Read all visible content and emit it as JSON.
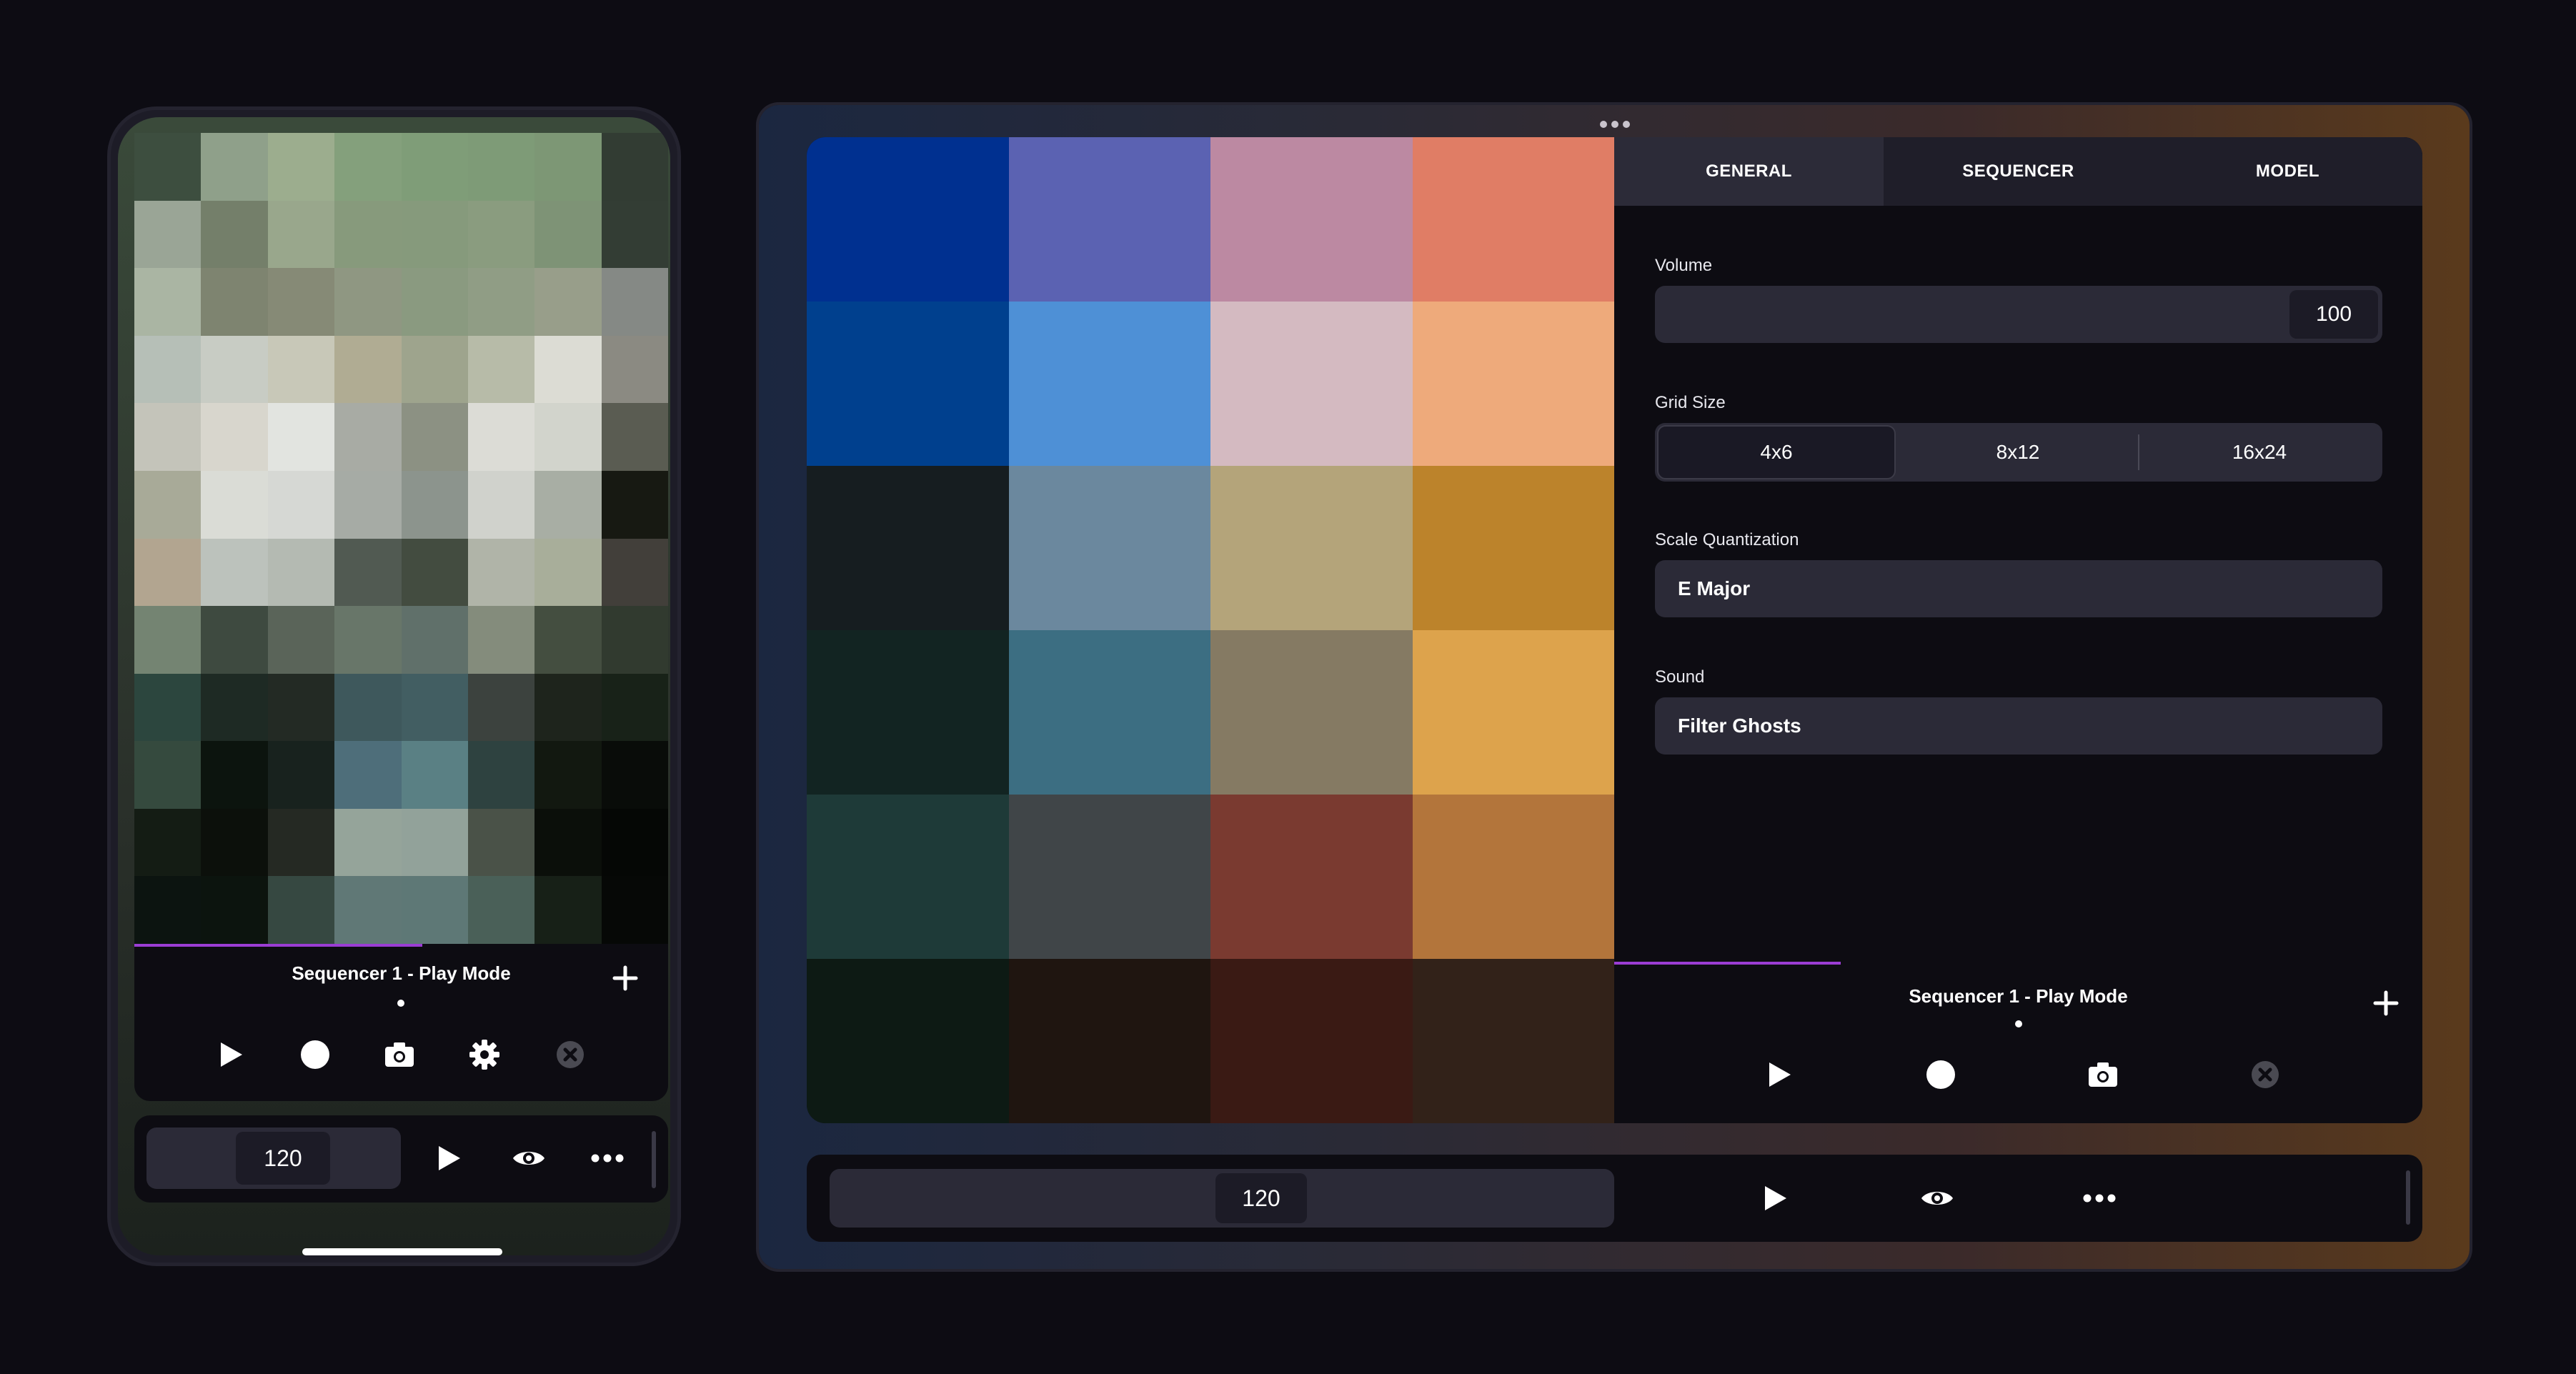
{
  "phone": {
    "grid_colors": [
      [
        "#3d4e3f",
        "#8fa08a",
        "#9cad8e",
        "#84a07c",
        "#7f9d78",
        "#7e9b77",
        "#7d9775",
        "#323c33"
      ],
      [
        "#9aa596",
        "#747f6a",
        "#99a78c",
        "#879a7c",
        "#869a7c",
        "#8a9c7f",
        "#7e9376",
        "#333d34"
      ],
      [
        "#aab5a3",
        "#7e8470",
        "#868a76",
        "#8f9782",
        "#8a9a80",
        "#909d85",
        "#989e8a",
        "#858985"
      ],
      [
        "#b6bfb7",
        "#c8ccc4",
        "#c8c8b8",
        "#b0ac93",
        "#9ea48d",
        "#b7bba8",
        "#dcdcd4",
        "#8b8a82"
      ],
      [
        "#c4c4ba",
        "#d8d6cd",
        "#e2e4e0",
        "#a8aba4",
        "#8c9183",
        "#dcdcd6",
        "#d2d4cc",
        "#5a5c52"
      ],
      [
        "#a8aa98",
        "#dadcd6",
        "#d6d8d4",
        "#a6aba5",
        "#8c948d",
        "#d0d2cc",
        "#a8aea4",
        "#171912"
      ],
      [
        "#b2a590",
        "#bcc2bc",
        "#b4bab2",
        "#515a52",
        "#434c40",
        "#b0b4a8",
        "#a8ae9a",
        "#423f3a"
      ],
      [
        "#748472",
        "#3e4a40",
        "#5a6459",
        "#687669",
        "#60706a",
        "#848c7c",
        "#444e40",
        "#313a2f"
      ],
      [
        "#2c463e",
        "#1e2a24",
        "#232a24",
        "#3e585c",
        "#425e62",
        "#3c423e",
        "#1e241c",
        "#182218"
      ],
      [
        "#354a3e",
        "#0c140e",
        "#18221e",
        "#4e6e7a",
        "#5a8084",
        "#2e4240",
        "#121810",
        "#090c09"
      ],
      [
        "#141c14",
        "#0c100b",
        "#252923",
        "#95a49a",
        "#92a29a",
        "#4a5248",
        "#0b0f0a",
        "#050705"
      ],
      [
        "#0c1410",
        "#0c140e",
        "#364841",
        "#607876",
        "#5e7876",
        "#4a6058",
        "#172017",
        "#060806"
      ]
    ],
    "sequencer_title": "Sequencer 1 - Play Mode",
    "tempo": "120",
    "progress_fraction": 0.54
  },
  "tablet": {
    "grid_colors": [
      [
        "#003090",
        "#5b62b2",
        "#bc89a2",
        "#e07d65"
      ],
      [
        "#00408e",
        "#4e90d6",
        "#d4bac1",
        "#eeaa7b"
      ],
      [
        "#161d20",
        "#6b889e",
        "#b4a47a",
        "#bc832b"
      ],
      [
        "#122422",
        "#3c6e82",
        "#857a63",
        "#dda34c"
      ],
      [
        "#1e3a38",
        "#404548",
        "#7a3a30",
        "#b3753b"
      ],
      [
        "#0d1a14",
        "#1f1510",
        "#3a1a14",
        "#322219"
      ]
    ],
    "tabs": [
      "GENERAL",
      "SEQUENCER",
      "MODEL"
    ],
    "settings": {
      "volume_label": "Volume",
      "volume_value": "100",
      "grid_size_label": "Grid Size",
      "grid_options": [
        "4x6",
        "8x12",
        "16x24"
      ],
      "grid_selected": "4x6",
      "scale_label": "Scale Quantization",
      "scale_value": "E Major",
      "sound_label": "Sound",
      "sound_value": "Filter Ghosts"
    },
    "sequencer_title": "Sequencer 1 - Play Mode",
    "tempo": "120",
    "progress_fraction": 0.28
  },
  "icons": [
    "play-icon",
    "record-icon",
    "camera-icon",
    "gear-icon",
    "close-icon",
    "plus-icon",
    "eye-icon",
    "more-icon"
  ],
  "colors": {
    "accent": "#9b3dd4",
    "background": "#0d0c13",
    "panel": "#0d0c12",
    "field": "#2b2a37"
  }
}
